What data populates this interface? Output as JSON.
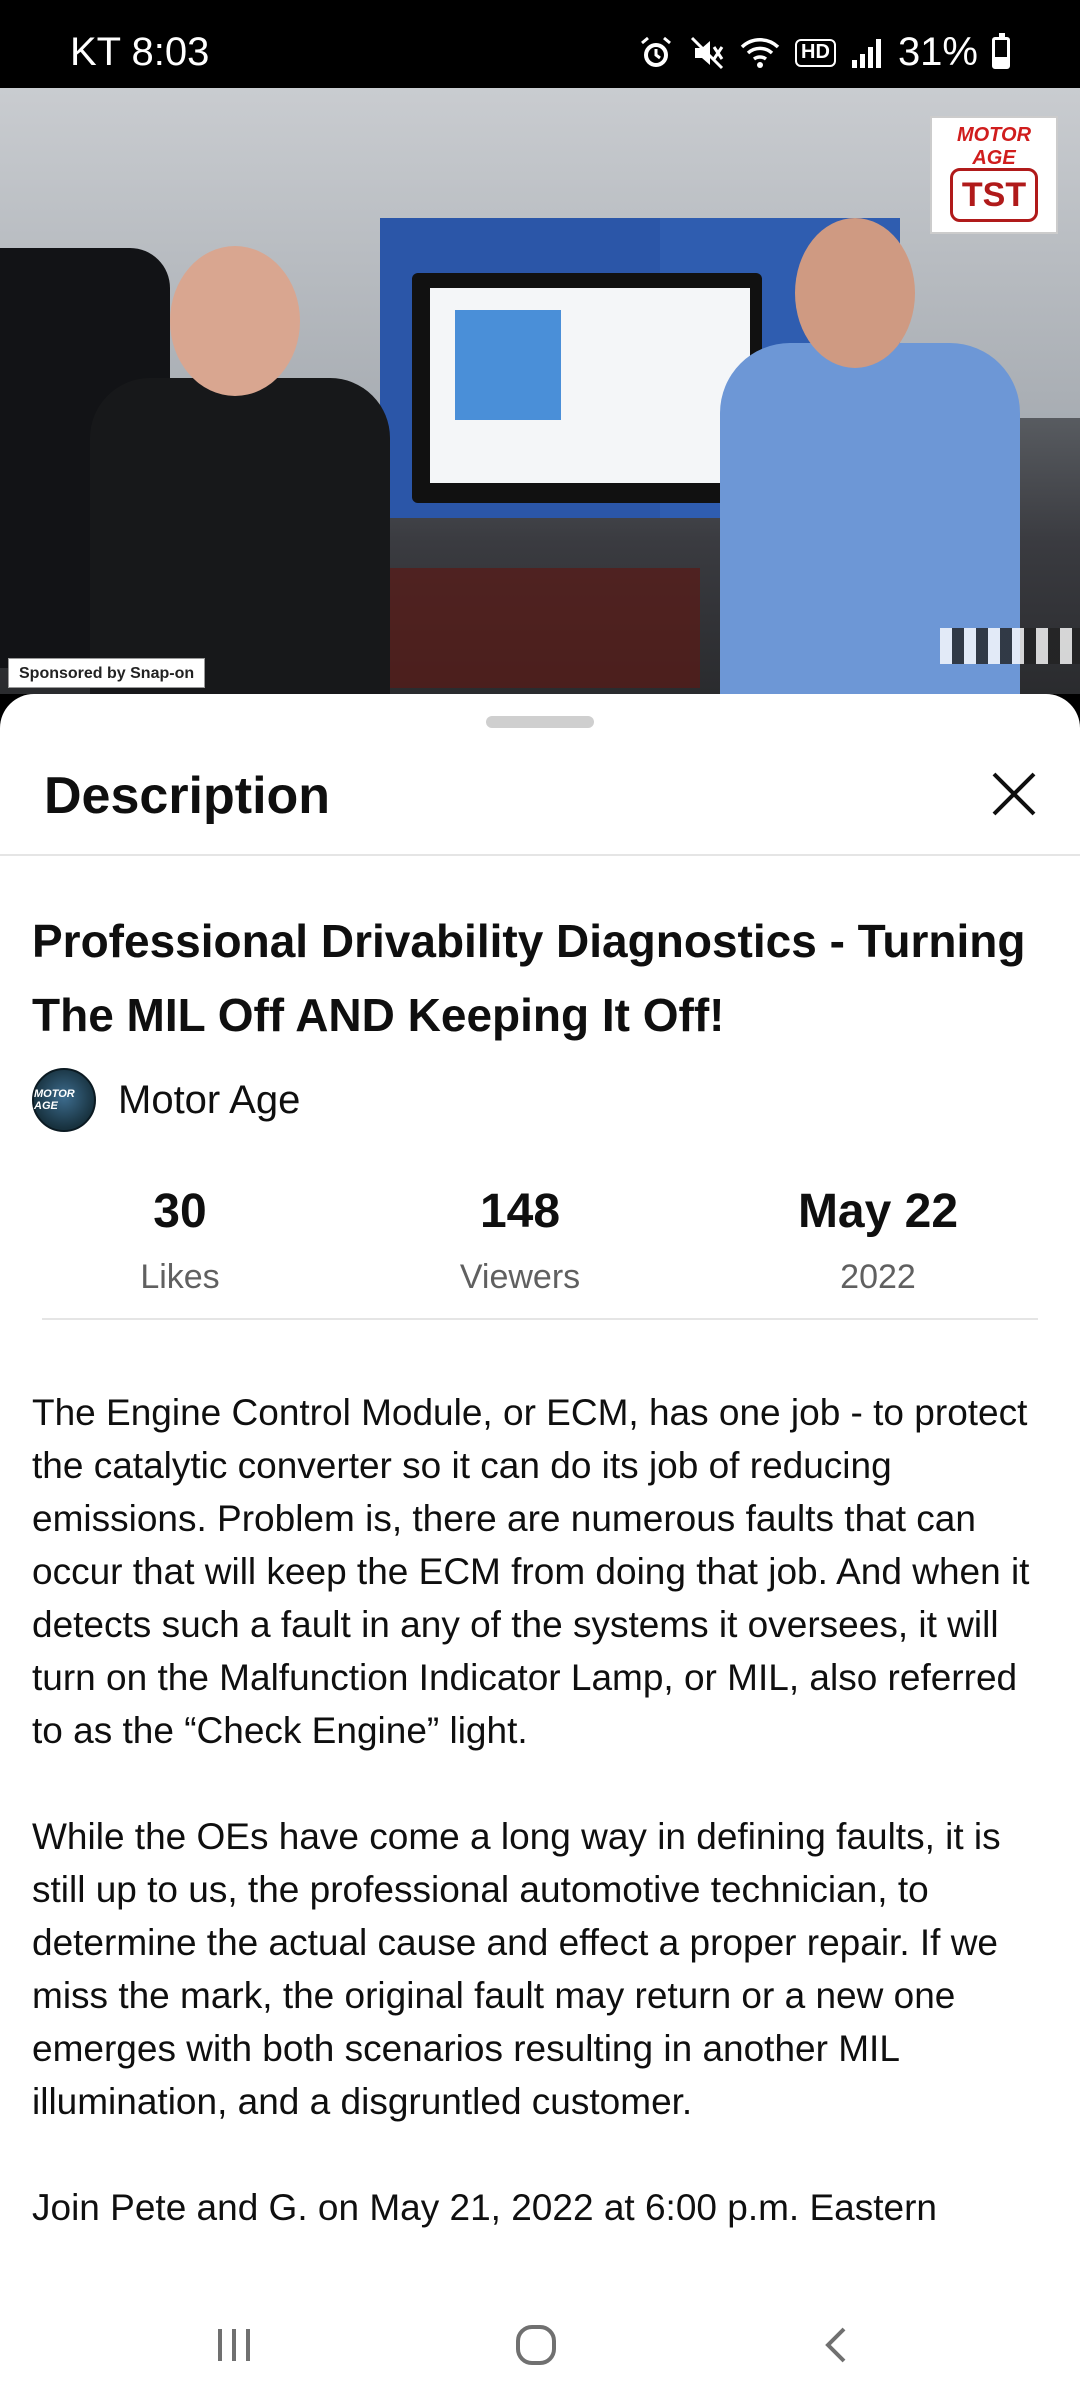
{
  "status_bar": {
    "carrier_time": "KT 8:03",
    "battery_percent": "31%",
    "battery_level": 0.31,
    "icons": [
      "alarm-icon",
      "mute-icon",
      "wifi-icon",
      "hd-icon",
      "signal-icon",
      "battery-icon"
    ],
    "hd_label": "HD"
  },
  "video": {
    "watermark_top": "MOTOR AGE",
    "watermark_logo": "TST",
    "sponsor_text": "Sponsored by Snap-on",
    "progress": 0.945
  },
  "sheet": {
    "title": "Description",
    "close_icon": "close-icon"
  },
  "video_info": {
    "title": "Professional Drivability Diagnostics - Turning The MIL Off AND Keeping It Off!",
    "channel_name": "Motor Age",
    "channel_avatar_text": "MOTOR AGE"
  },
  "stats": [
    {
      "value": "30",
      "label": "Likes"
    },
    {
      "value": "148",
      "label": "Viewers"
    },
    {
      "value": "May 22",
      "label": "2022"
    }
  ],
  "description": {
    "paragraphs": [
      "The Engine Control Module, or ECM, has one job - to protect the catalytic converter so it can do its job of reducing emissions. Problem is, there are numerous faults that can occur that will keep the ECM from doing that job. And when it detects such a fault in any of the systems it oversees, it will turn on the Malfunction Indicator Lamp, or MIL, also referred to as the “Check Engine” light.",
      "While the OEs have come a long way in defining faults, it is still up to us, the professional automotive technician, to determine the actual cause and effect a proper repair. If we miss the mark, the original fault may return or a new one emerges with both scenarios resulting in another MIL illumination, and a disgruntled customer.",
      "Join Pete and G. on May 21, 2022 at 6:00 p.m. Eastern"
    ]
  },
  "nav_bar": {
    "buttons": [
      "recent-apps-icon",
      "home-icon",
      "back-icon"
    ]
  },
  "colors": {
    "progress": "#e53935",
    "text_primary": "#0f0f0f",
    "text_secondary": "#606060",
    "divider": "#e5e5e5"
  }
}
